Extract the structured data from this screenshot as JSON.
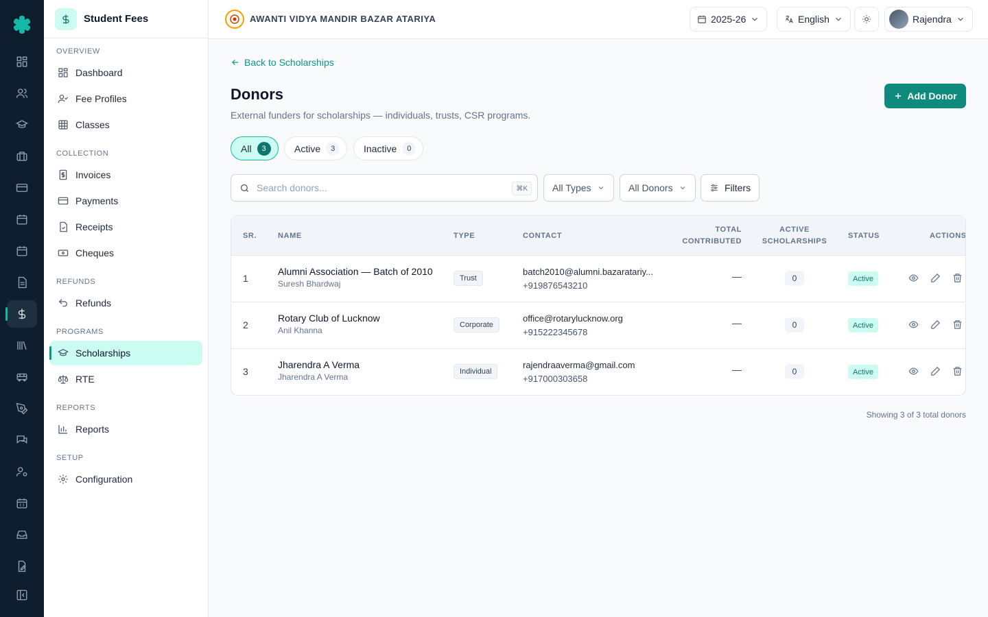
{
  "colors": {
    "accent": "#0f8b7e",
    "accent_light": "#ccfbf1",
    "rail": "#0f1e2e"
  },
  "rail": {
    "icons": [
      "dashboard-icon",
      "users-icon",
      "graduation-cap-icon",
      "briefcase-icon",
      "card-icon",
      "calendar-icon",
      "calendar-icon",
      "document-icon",
      "dollar-icon",
      "library-icon",
      "bus-icon",
      "pen-tool-icon",
      "messages-icon",
      "user-settings-icon",
      "calendar-grid-icon",
      "inbox-icon",
      "file-edit-icon",
      "collapse-icon"
    ]
  },
  "sidebar": {
    "title": "Student Fees",
    "sections": {
      "overview": "OVERVIEW",
      "collection": "COLLECTION",
      "refunds": "REFUNDS",
      "programs": "PROGRAMS",
      "reports": "REPORTS",
      "setup": "SETUP"
    },
    "items": {
      "dashboard": "Dashboard",
      "fee_profiles": "Fee Profiles",
      "classes": "Classes",
      "invoices": "Invoices",
      "payments": "Payments",
      "receipts": "Receipts",
      "cheques": "Cheques",
      "refunds": "Refunds",
      "scholarships": "Scholarships",
      "rte": "RTE",
      "reports": "Reports",
      "configuration": "Configuration"
    }
  },
  "header": {
    "school": "AWANTI VIDYA MANDIR BAZAR ATARIYA",
    "year": "2025-26",
    "language": "English",
    "user": "Rajendra"
  },
  "page": {
    "back": "Back to Scholarships",
    "title": "Donors",
    "subtitle": "External funders for scholarships — individuals, trusts, CSR programs.",
    "add_button": "Add Donor"
  },
  "tabs": [
    {
      "label": "All",
      "count": "3"
    },
    {
      "label": "Active",
      "count": "3"
    },
    {
      "label": "Inactive",
      "count": "0"
    }
  ],
  "filters": {
    "search_placeholder": "Search donors...",
    "shortcut": "⌘K",
    "types": "All Types",
    "donors": "All Donors",
    "filters": "Filters"
  },
  "table": {
    "headers": {
      "sr": "SR.",
      "name": "NAME",
      "type": "TYPE",
      "contact": "CONTACT",
      "total_1": "TOTAL",
      "total_2": "CONTRIBUTED",
      "active_1": "ACTIVE",
      "active_2": "SCHOLARSHIPS",
      "status": "STATUS",
      "actions": "ACTIONS"
    },
    "rows": [
      {
        "sr": "1",
        "name": "Alumni Association — Batch of 2010",
        "sub": "Suresh Bhardwaj",
        "type": "Trust",
        "email": "batch2010@alumni.bazaratariy...",
        "phone": "+919876543210",
        "total": "—",
        "active": "0",
        "status": "Active"
      },
      {
        "sr": "2",
        "name": "Rotary Club of Lucknow",
        "sub": "Anil Khanna",
        "type": "Corporate",
        "email": "office@rotarylucknow.org",
        "phone": "+915222345678",
        "total": "—",
        "active": "0",
        "status": "Active"
      },
      {
        "sr": "3",
        "name": "Jharendra A Verma",
        "sub": "Jharendra A Verma",
        "type": "Individual",
        "email": "rajendraaverma@gmail.com",
        "phone": "+917000303658",
        "total": "—",
        "active": "0",
        "status": "Active"
      }
    ]
  },
  "footer": "Showing 3 of 3 total donors"
}
